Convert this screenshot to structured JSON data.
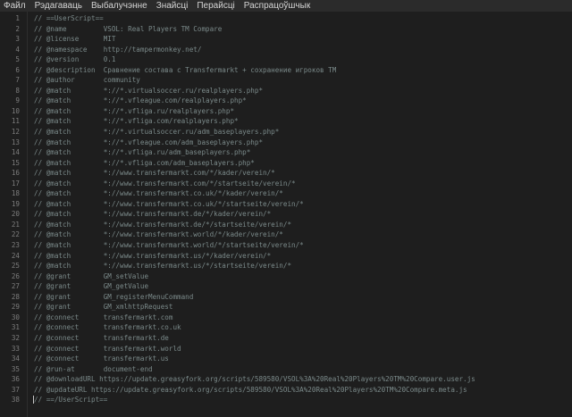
{
  "menu": {
    "items": [
      "Файл",
      "Рэдагаваць",
      "Выбалучэнне",
      "Знайсці",
      "Перайсці",
      "Распрацоўшчык"
    ]
  },
  "editor": {
    "lines": [
      "// ==UserScript==",
      "// @name         VSOL: Real Players TM Compare",
      "// @license      MIT",
      "// @namespace    http://tampermonkey.net/",
      "// @version      0.1",
      "// @description  Сравнение состава с Transfermarkt + сохранение игроков TM",
      "// @author       community",
      "// @match        *://*.virtualsoccer.ru/realplayers.php*",
      "// @match        *://*.vfleague.com/realplayers.php*",
      "// @match        *://*.vfliga.ru/realplayers.php*",
      "// @match        *://*.vfliga.com/realplayers.php*",
      "// @match        *://*.virtualsoccer.ru/adm_baseplayers.php*",
      "// @match        *://*.vfleague.com/adm_baseplayers.php*",
      "// @match        *://*.vfliga.ru/adm_baseplayers.php*",
      "// @match        *://*.vfliga.com/adm_baseplayers.php*",
      "// @match        *://www.transfermarkt.com/*/kader/verein/*",
      "// @match        *://www.transfermarkt.com/*/startseite/verein/*",
      "// @match        *://www.transfermarkt.co.uk/*/kader/verein/*",
      "// @match        *://www.transfermarkt.co.uk/*/startseite/verein/*",
      "// @match        *://www.transfermarkt.de/*/kader/verein/*",
      "// @match        *://www.transfermarkt.de/*/startseite/verein/*",
      "// @match        *://www.transfermarkt.world/*/kader/verein/*",
      "// @match        *://www.transfermarkt.world/*/startseite/verein/*",
      "// @match        *://www.transfermarkt.us/*/kader/verein/*",
      "// @match        *://www.transfermarkt.us/*/startseite/verein/*",
      "// @grant        GM_setValue",
      "// @grant        GM_getValue",
      "// @grant        GM_registerMenuCommand",
      "// @grant        GM_xmlhttpRequest",
      "// @connect      transfermarkt.com",
      "// @connect      transfermarkt.co.uk",
      "// @connect      transfermarkt.de",
      "// @connect      transfermarkt.world",
      "// @connect      transfermarkt.us",
      "// @run-at       document-end",
      "// @downloadURL https://update.greasyfork.org/scripts/589580/VSOL%3A%20Real%20Players%20TM%20Compare.user.js",
      "// @updateURL https://update.greasyfork.org/scripts/589580/VSOL%3A%20Real%20Players%20TM%20Compare.meta.js",
      "// ==/UserScript=="
    ]
  },
  "colors": {
    "background": "#1e1e1e",
    "comment": "#7b8a8a",
    "line_number": "#7d7d7d",
    "menubar": "#2b2b2b"
  }
}
